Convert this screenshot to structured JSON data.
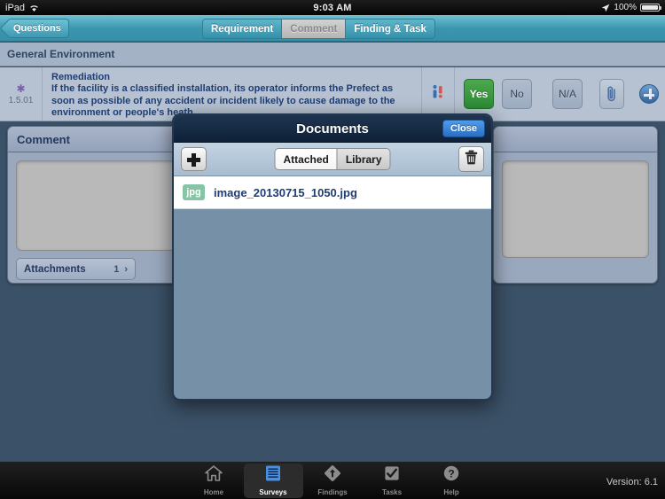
{
  "statusbar": {
    "device": "iPad",
    "wifi_icon": "wifi-icon",
    "time": "9:03 AM",
    "location_icon": "location-arrow-icon",
    "battery_pct": "100%",
    "battery_icon": "battery-icon"
  },
  "navbar": {
    "back_label": "Questions",
    "segments": [
      {
        "label": "Requirement",
        "selected": false
      },
      {
        "label": "Comment",
        "selected": true
      },
      {
        "label": "Finding & Task",
        "selected": false
      }
    ]
  },
  "section": {
    "title": "General Environment"
  },
  "question": {
    "required_marker": "✱",
    "number": "1.5.01",
    "title": "Remediation",
    "text": "If the facility is a classified installation, its operator informs the Prefect as soon as possible of any accident or incident likely to cause damage to the environment or people's heath.",
    "info_icon": "info-alert-icon",
    "answers": [
      {
        "label": "Yes",
        "selected": true
      },
      {
        "label": "No",
        "selected": false
      },
      {
        "label": "N/A",
        "selected": false
      }
    ],
    "attachment_icon": "paperclip-icon",
    "add_icon": "plus-circle-icon"
  },
  "comment_panel": {
    "title": "Comment",
    "textarea_value": "",
    "textarea_placeholder": "",
    "attachments_label": "Attachments",
    "attachments_count": "1",
    "chevron": "›"
  },
  "right_panel": {
    "title": "",
    "textarea_value": ""
  },
  "modal": {
    "title": "Documents",
    "close_label": "Close",
    "add_icon": "plus-icon",
    "delete_icon": "trash-icon",
    "segments": [
      {
        "label": "Attached",
        "selected": true
      },
      {
        "label": "Library",
        "selected": false
      }
    ],
    "files": [
      {
        "ext": "jpg",
        "name": "image_20130715_1050.jpg"
      }
    ]
  },
  "tabbar": {
    "tabs": [
      {
        "label": "Home",
        "icon": "home-icon",
        "selected": false
      },
      {
        "label": "Surveys",
        "icon": "surveys-icon",
        "selected": true
      },
      {
        "label": "Findings",
        "icon": "findings-icon",
        "selected": false
      },
      {
        "label": "Tasks",
        "icon": "tasks-icon",
        "selected": false
      },
      {
        "label": "Help",
        "icon": "help-icon",
        "selected": false
      }
    ],
    "version": "Version: 6.1"
  },
  "colors": {
    "accent_teal": "#3c95ae",
    "accent_blue": "#2a6fc4",
    "selected_green": "#2d8b37",
    "modal_body": "#7690a8",
    "app_background": "#3b5167",
    "ext_badge": "#86c4a6"
  }
}
